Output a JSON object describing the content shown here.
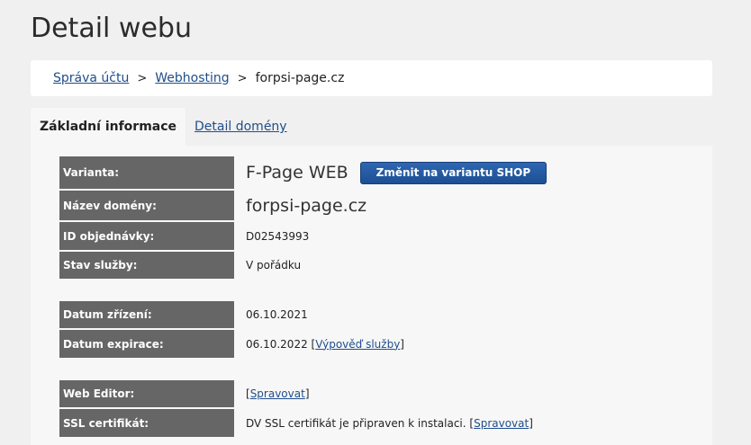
{
  "page": {
    "title": "Detail webu"
  },
  "breadcrumb": {
    "items": [
      "Správa účtu",
      "Webhosting"
    ],
    "current": "forpsi-page.cz",
    "separator": ">"
  },
  "tabs": [
    {
      "label": "Základní informace",
      "active": true
    },
    {
      "label": "Detail domény",
      "active": false
    }
  ],
  "details": {
    "variant": {
      "label": "Varianta:",
      "value": "F-Page WEB",
      "button": "Změnit na variantu SHOP"
    },
    "domain": {
      "label": "Název domény:",
      "value": "forpsi-page.cz"
    },
    "order_id": {
      "label": "ID objednávky:",
      "value": "D02543993"
    },
    "status": {
      "label": "Stav služby:",
      "value": "V pořádku"
    },
    "created": {
      "label": "Datum zřízení:",
      "value": "06.10.2021"
    },
    "expiration": {
      "label": "Datum expirace:",
      "value": "06.10.2022",
      "link": "Výpověď služby"
    },
    "web_editor": {
      "label": "Web Editor:",
      "link": "Spravovat"
    },
    "ssl": {
      "label": "SSL certifikát:",
      "value": "DV SSL certifikát je připraven k instalaci.",
      "link": "Spravovat"
    }
  },
  "colors": {
    "link": "#1f4e8c",
    "label_bg": "#666666",
    "button_bg": "#1c4f93"
  }
}
